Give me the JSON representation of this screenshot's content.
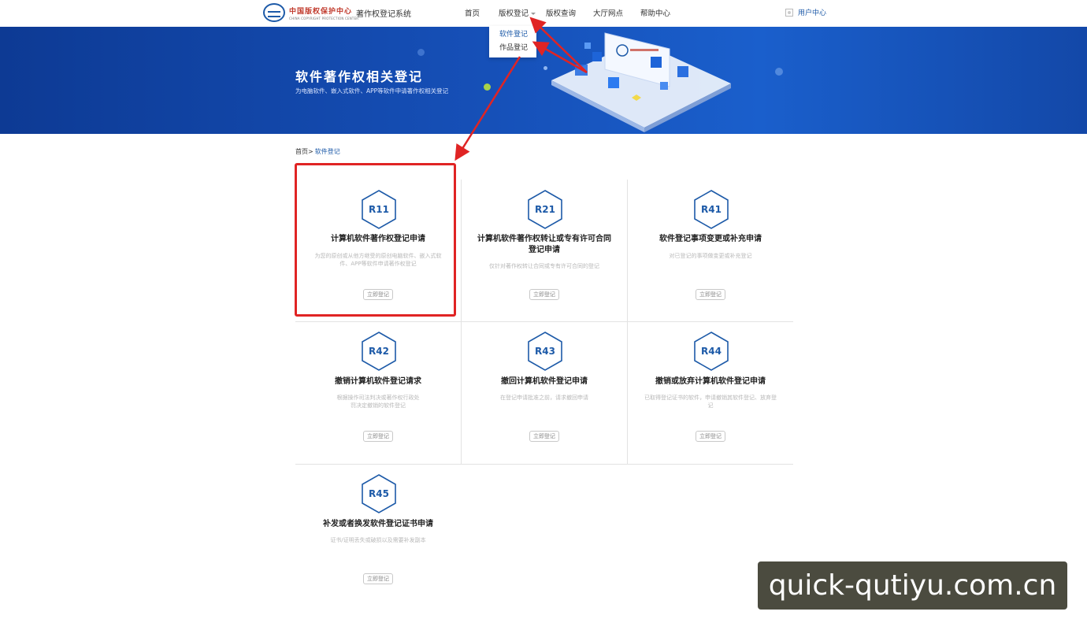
{
  "header": {
    "logo_cn": "中国版权保护中心",
    "logo_en": "CHINA COPYRIGHT PROTECTION CENTER",
    "system_title": "著作权登记系统",
    "nav": [
      {
        "label": "首页"
      },
      {
        "label": "版权登记"
      },
      {
        "label": "版权查询"
      },
      {
        "label": "大厅网点"
      },
      {
        "label": "帮助中心"
      }
    ],
    "user_center": "用户中心"
  },
  "dropdown": {
    "items": [
      {
        "label": "软件登记"
      },
      {
        "label": "作品登记"
      }
    ]
  },
  "banner": {
    "title": "软件著作权相关登记",
    "subtitle": "为电脑软件、嵌入式软件、APP等软件申请著作权相关登记"
  },
  "breadcrumb": {
    "home": "首页>",
    "current": "软件登记"
  },
  "cards": [
    {
      "code": "R11",
      "title": "计算机软件著作权登记申请",
      "desc": "为您的原创或从他方继受的原创电脑软件、嵌入式软件、APP等软件申请著作权登记",
      "button": "立即登记"
    },
    {
      "code": "R21",
      "title": "计算机软件著作权转让或专有许可合同登记申请",
      "desc": "仅针对著作权转让合同或专有许可合同的登记",
      "button": "立即登记"
    },
    {
      "code": "R41",
      "title": "软件登记事项变更或补充申请",
      "desc": "对已登记的事项做变更或补充登记",
      "button": "立即登记"
    },
    {
      "code": "R42",
      "title": "撤销计算机软件登记请求",
      "desc": "根据操作司法判决或著作权行政处罚决定撤销的软件登记",
      "button": "立即登记"
    },
    {
      "code": "R43",
      "title": "撤回计算机软件登记申请",
      "desc": "在登记申请批准之前，请求撤回申请",
      "button": "立即登记"
    },
    {
      "code": "R44",
      "title": "撤销或放弃计算机软件登记申请",
      "desc": "已取得登记证书的软件，申请撤销其软件登记、放弃登记",
      "button": "立即登记"
    },
    {
      "code": "R45",
      "title": "补发或者换发软件登记证书申请",
      "desc": "证书/证明丢失或破损以及需要补发副本",
      "button": "立即登记"
    }
  ],
  "watermark": "quick-qutiyu.com.cn",
  "colors": {
    "accent": "#1d5aa8",
    "banner": "#1650b8",
    "annotation": "#e02424"
  }
}
